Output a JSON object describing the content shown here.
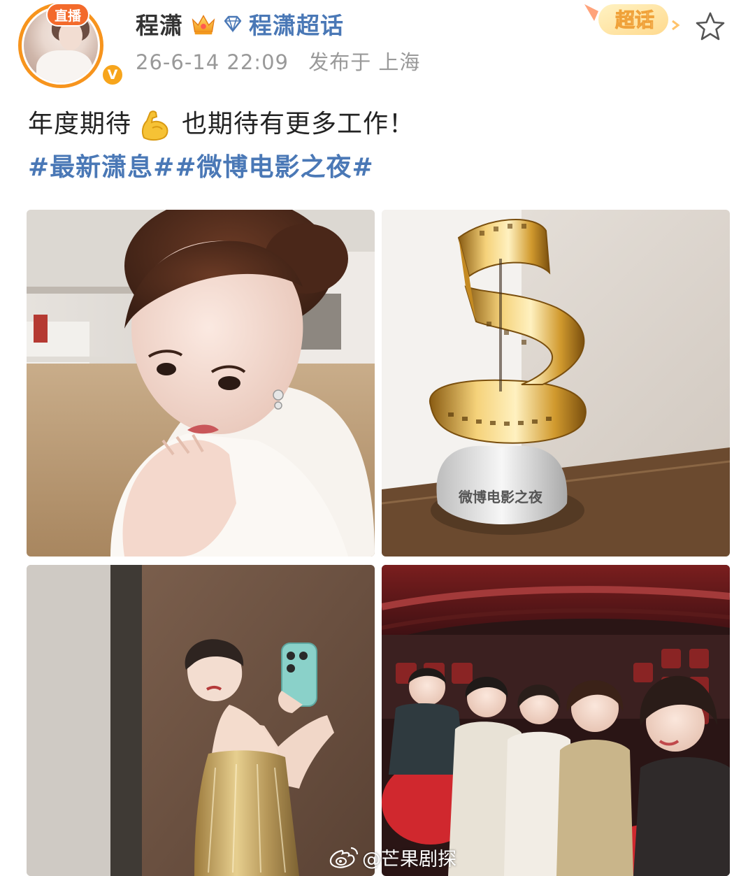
{
  "header": {
    "live_badge": "直播",
    "verified_badge": "V",
    "user_name": "程潇",
    "supertopic_link": "程潇超话",
    "timestamp": "26-6-14 22:09",
    "location": "发布于 上海",
    "chaohua_badge": "超话"
  },
  "post": {
    "text_part1": "年度期待",
    "text_part2": "也期待有更多工作！",
    "hashtags": "#最新潇息##微博电影之夜#",
    "emoji_icon": "flexed-biceps"
  },
  "photos": [
    {
      "name": "selfie-portrait"
    },
    {
      "name": "film-reel-trophy",
      "engraving": "微博电影之夜"
    },
    {
      "name": "mirror-selfie"
    },
    {
      "name": "group-theater-selfie"
    }
  ],
  "watermark": {
    "text": "@芒果剧探"
  },
  "colors": {
    "link": "#4a78b6",
    "live_badge": "#f36a2b",
    "avatar_ring": "#f7941d",
    "meta_text": "#999999"
  }
}
